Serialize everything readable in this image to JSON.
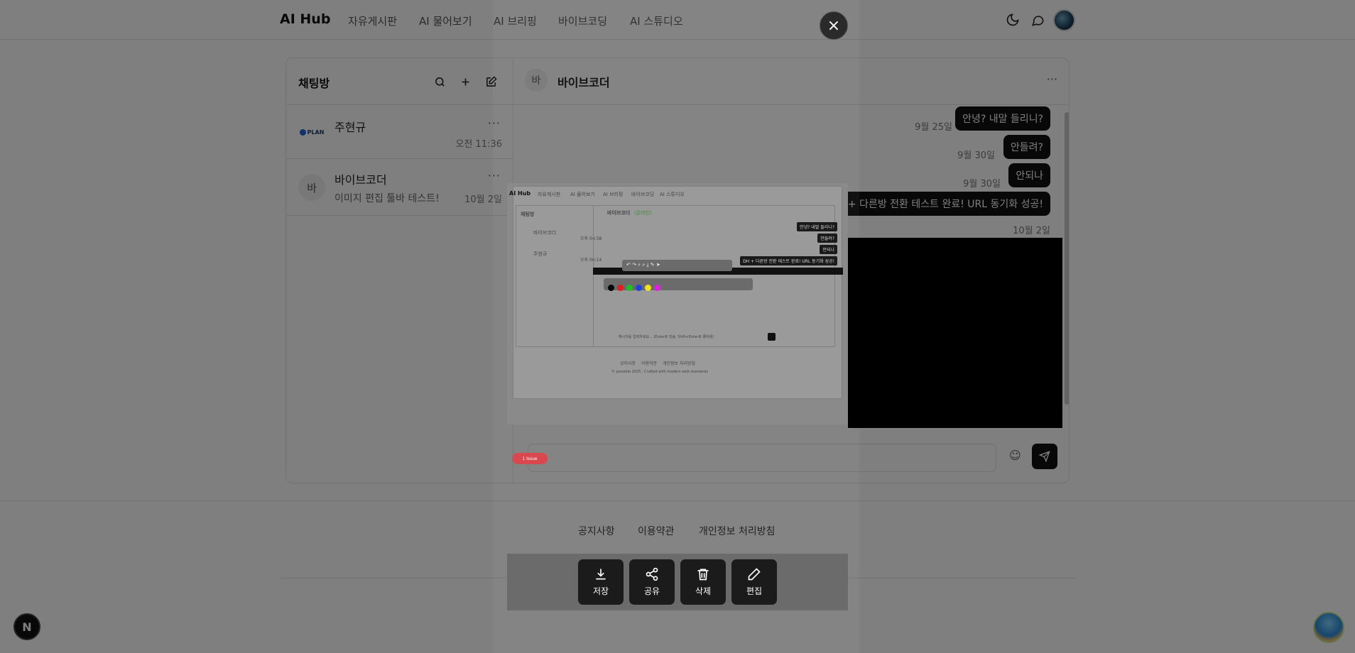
{
  "header": {
    "logo": "AI Hub",
    "nav": [
      "자유게시판",
      "AI 물어보기",
      "AI 브리핑",
      "바이브코딩",
      "AI 스튜디오"
    ]
  },
  "sidebar": {
    "title": "채팅방",
    "rooms": [
      {
        "name": "주현규",
        "last_message": "",
        "time": "오전 11:36",
        "avatar_text": "PLAN"
      },
      {
        "name": "바이브코더",
        "last_message": "이미지 편집 툴바 테스트!",
        "time": "10월 2일",
        "avatar_text": "바"
      }
    ]
  },
  "conversation": {
    "title": "바이브코더",
    "avatar_text": "바",
    "messages": [
      {
        "text": "안녕? 내말 들리니?",
        "time": "9월 25일"
      },
      {
        "text": "안들려?",
        "time": "9월 30일"
      },
      {
        "text": "안되나",
        "time": "9월 30일"
      },
      {
        "text": "+ 다른방 전환 테스트 완료! URL 동기화 성공!",
        "time": "10월 2일"
      }
    ]
  },
  "footer": {
    "links": [
      "공지사항",
      "이용약관",
      "개인정보 처리방침"
    ]
  },
  "image_viewer": {
    "close_symbol": "×",
    "actions": [
      {
        "label": "저장",
        "icon": "download-icon"
      },
      {
        "label": "공유",
        "icon": "share-icon"
      },
      {
        "label": "삭제",
        "icon": "trash-icon"
      },
      {
        "label": "편집",
        "icon": "pen-icon"
      }
    ],
    "thumbnail": {
      "logo": "AI Hub",
      "nav": [
        "자유게시판",
        "AI 물어보기",
        "AI 브리핑",
        "바이브코딩",
        "AI 스튜디오"
      ],
      "side_title": "채팅방",
      "rooms": [
        {
          "name": "바이브코더",
          "time": "오후 04:58"
        },
        {
          "name": "주현규",
          "time": "오후 06:14"
        }
      ],
      "chat_title": "바이브코더",
      "chat_status": "(온라인)",
      "bubbles": [
        "안녕? 내말 들리니?",
        "안들려?",
        "안되나",
        "DH + 다른방 전환 테스트 완료! URL 동기화 성공!"
      ],
      "input_placeholder": "메시지를 입력하세요... (Enter로 전송, Shift+Enter로 줄바꿈)",
      "footer_links": [
        "공지사항",
        "이용약관",
        "개인정보 처리방침"
      ],
      "copyright": "© possible 2025 · Crafted with modern web standards",
      "issue_badge": "1 Issue"
    }
  },
  "colors": {
    "accent": "#111111",
    "overlay": "rgba(0,0,0,0.5)",
    "issue": "#d9484f"
  }
}
